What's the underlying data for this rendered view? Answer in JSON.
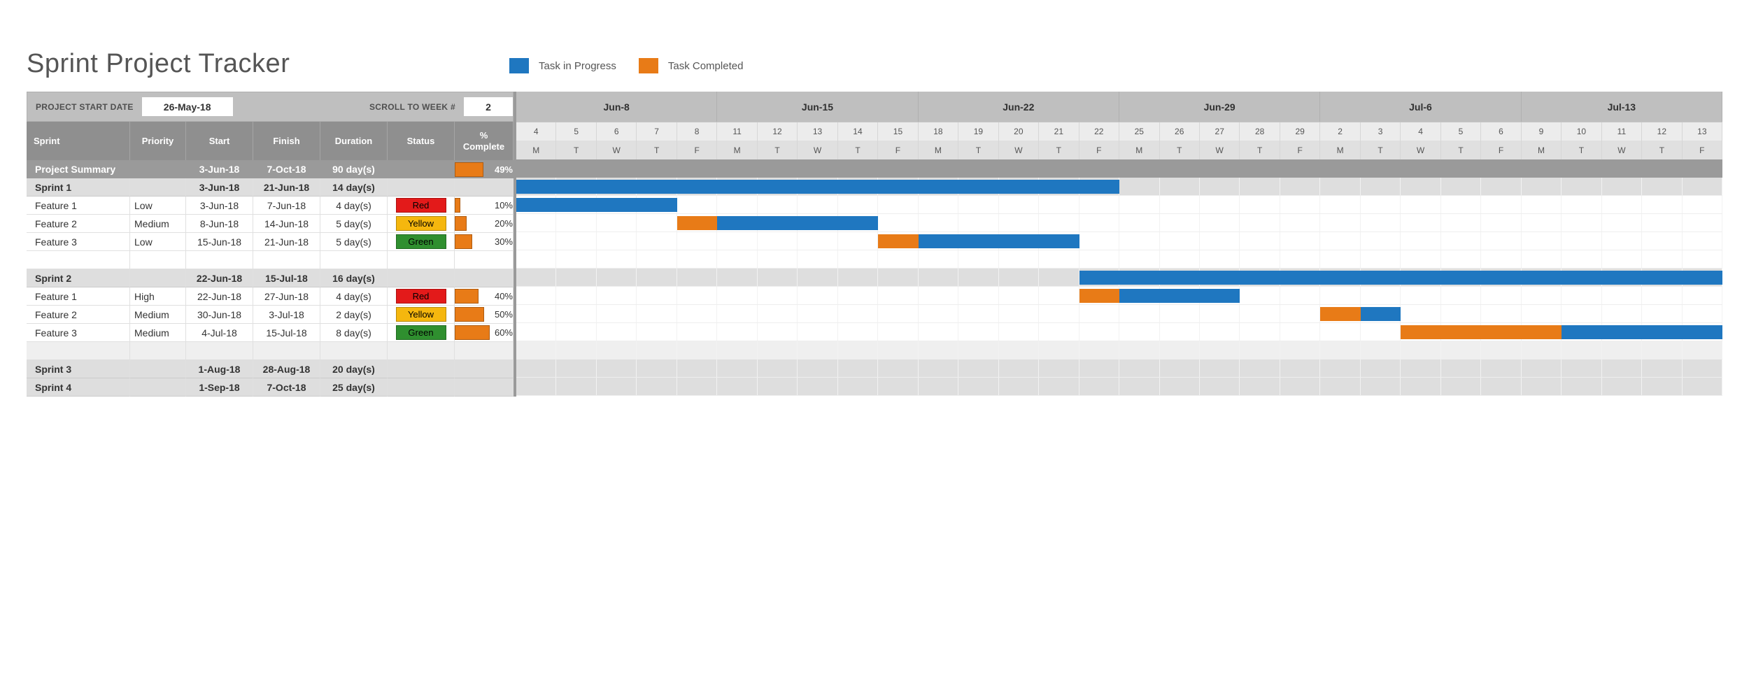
{
  "title": "Sprint Project Tracker",
  "legend": {
    "in_progress": {
      "label": "Task in Progress",
      "color": "#1f77c0"
    },
    "completed": {
      "label": "Task Completed",
      "color": "#e87b17"
    }
  },
  "controls": {
    "start_label": "PROJECT START DATE",
    "start_value": "26-May-18",
    "scroll_label": "SCROLL TO WEEK #",
    "scroll_value": "2"
  },
  "columns": [
    "Sprint",
    "Priority",
    "Start",
    "Finish",
    "Duration",
    "Status",
    "% Complete"
  ],
  "status_colors": {
    "Red": "#e31a1a",
    "Yellow": "#f5b70e",
    "Green": "#2f8f2f"
  },
  "rows": [
    {
      "type": "summary",
      "name": "Project Summary",
      "start": "3-Jun-18",
      "finish": "7-Oct-18",
      "duration": "90 day(s)",
      "pct": 49
    },
    {
      "type": "sprint",
      "name": "Sprint 1",
      "start": "3-Jun-18",
      "finish": "21-Jun-18",
      "duration": "14 day(s)",
      "bar": {
        "start_day": 0,
        "len": 15,
        "completed": 0
      }
    },
    {
      "type": "task",
      "name": "Feature 1",
      "priority": "Low",
      "start": "3-Jun-18",
      "finish": "7-Jun-18",
      "duration": "4 day(s)",
      "status": "Red",
      "pct": 10,
      "bar": {
        "start_day": -1,
        "len": 5,
        "completed": 1
      }
    },
    {
      "type": "task",
      "name": "Feature 2",
      "priority": "Medium",
      "start": "8-Jun-18",
      "finish": "14-Jun-18",
      "duration": "5 day(s)",
      "status": "Yellow",
      "pct": 20,
      "bar": {
        "start_day": 4,
        "len": 5,
        "completed": 1
      }
    },
    {
      "type": "task",
      "name": "Feature 3",
      "priority": "Low",
      "start": "15-Jun-18",
      "finish": "21-Jun-18",
      "duration": "5 day(s)",
      "status": "Green",
      "pct": 30,
      "bar": {
        "start_day": 9,
        "len": 5,
        "completed": 1
      }
    },
    {
      "type": "blank"
    },
    {
      "type": "sprint",
      "name": "Sprint 2",
      "start": "22-Jun-18",
      "finish": "15-Jul-18",
      "duration": "16 day(s)",
      "bar": {
        "start_day": 14,
        "len": 30,
        "completed": 0
      }
    },
    {
      "type": "task",
      "name": "Feature 1",
      "priority": "High",
      "start": "22-Jun-18",
      "finish": "27-Jun-18",
      "duration": "4 day(s)",
      "status": "Red",
      "pct": 40,
      "bar": {
        "start_day": 14,
        "len": 4,
        "completed": 1
      }
    },
    {
      "type": "task",
      "name": "Feature 2",
      "priority": "Medium",
      "start": "30-Jun-18",
      "finish": "3-Jul-18",
      "duration": "2 day(s)",
      "status": "Yellow",
      "pct": 50,
      "bar": {
        "start_day": 20,
        "len": 2,
        "completed": 1
      }
    },
    {
      "type": "task",
      "name": "Feature 3",
      "priority": "Medium",
      "start": "4-Jul-18",
      "finish": "15-Jul-18",
      "duration": "8 day(s)",
      "status": "Green",
      "pct": 60,
      "bar": {
        "start_day": 22,
        "len": 8,
        "completed": 4
      }
    },
    {
      "type": "altblank"
    },
    {
      "type": "sprint",
      "name": "Sprint 3",
      "start": "1-Aug-18",
      "finish": "28-Aug-18",
      "duration": "20 day(s)"
    },
    {
      "type": "sprint",
      "name": "Sprint 4",
      "start": "1-Sep-18",
      "finish": "7-Oct-18",
      "duration": "25 day(s)"
    }
  ],
  "timeline": {
    "weeks": [
      "Jun-8",
      "Jun-15",
      "Jun-22",
      "Jun-29",
      "Jul-6",
      "Jul-13"
    ],
    "days": [
      "4",
      "5",
      "6",
      "7",
      "8",
      "11",
      "12",
      "13",
      "14",
      "15",
      "18",
      "19",
      "20",
      "21",
      "22",
      "25",
      "26",
      "27",
      "28",
      "29",
      "2",
      "3",
      "4",
      "5",
      "6",
      "9",
      "10",
      "11",
      "12",
      "13"
    ],
    "dow": [
      "M",
      "T",
      "W",
      "T",
      "F",
      "M",
      "T",
      "W",
      "T",
      "F",
      "M",
      "T",
      "W",
      "T",
      "F",
      "M",
      "T",
      "W",
      "T",
      "F",
      "M",
      "T",
      "W",
      "T",
      "F",
      "M",
      "T",
      "W",
      "T",
      "F"
    ]
  },
  "chart_data": {
    "type": "gantt",
    "title": "Sprint Project Tracker",
    "x_unit": "working-day index from 4-Jun-18",
    "series": [
      {
        "name": "Sprint 1",
        "kind": "group",
        "start": 0,
        "length": 15,
        "completed": 0
      },
      {
        "name": "Sprint 1 / Feature 1",
        "kind": "task",
        "start": -1,
        "length": 5,
        "completed": 1,
        "status": "Red",
        "pct_complete": 10
      },
      {
        "name": "Sprint 1 / Feature 2",
        "kind": "task",
        "start": 4,
        "length": 5,
        "completed": 1,
        "status": "Yellow",
        "pct_complete": 20
      },
      {
        "name": "Sprint 1 / Feature 3",
        "kind": "task",
        "start": 9,
        "length": 5,
        "completed": 1,
        "status": "Green",
        "pct_complete": 30
      },
      {
        "name": "Sprint 2",
        "kind": "group",
        "start": 14,
        "length": 30,
        "completed": 0
      },
      {
        "name": "Sprint 2 / Feature 1",
        "kind": "task",
        "start": 14,
        "length": 4,
        "completed": 1,
        "status": "Red",
        "pct_complete": 40
      },
      {
        "name": "Sprint 2 / Feature 2",
        "kind": "task",
        "start": 20,
        "length": 2,
        "completed": 1,
        "status": "Yellow",
        "pct_complete": 50
      },
      {
        "name": "Sprint 2 / Feature 3",
        "kind": "task",
        "start": 22,
        "length": 8,
        "completed": 4,
        "status": "Green",
        "pct_complete": 60
      }
    ],
    "legend": {
      "Task in Progress": "#1f77c0",
      "Task Completed": "#e87b17"
    }
  }
}
